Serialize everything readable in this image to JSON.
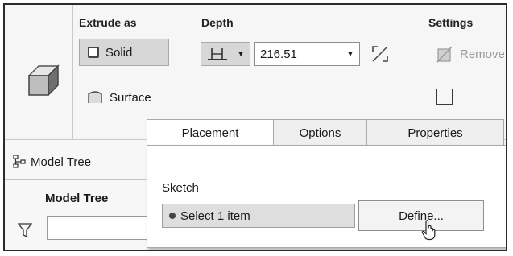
{
  "ribbon": {
    "extrude_as_label": "Extrude as",
    "solid_label": "Solid",
    "surface_label": "Surface",
    "depth_label": "Depth",
    "depth_value": "216.51",
    "settings_label": "Settings",
    "remove_label": "Remove"
  },
  "tabs": [
    {
      "label": "Placement",
      "active": true
    },
    {
      "label": "Options",
      "active": false
    },
    {
      "label": "Properties",
      "active": false
    }
  ],
  "model_tree": {
    "tab_label": "Model Tree",
    "title": "Model Tree",
    "filter_value": ""
  },
  "placement_panel": {
    "sketch_label": "Sketch",
    "select_text": "Select 1 item",
    "define_label": "Define..."
  },
  "icons": {
    "extrude": "cube-icon",
    "solid": "solid-box-icon",
    "surface": "surface-icon",
    "depth_type": "depth-blind-icon",
    "flip": "flip-direction-icon",
    "remove": "remove-material-icon",
    "model_tree": "model-tree-icon",
    "filter": "filter-icon",
    "cursor": "mouse-cursor-icon"
  },
  "colors": {
    "ribbon_bg": "#f6f6f6",
    "pressed_button_bg": "#d7d7d7",
    "select_field_bg": "#dedede",
    "frame_border": "#2b2b2b"
  }
}
